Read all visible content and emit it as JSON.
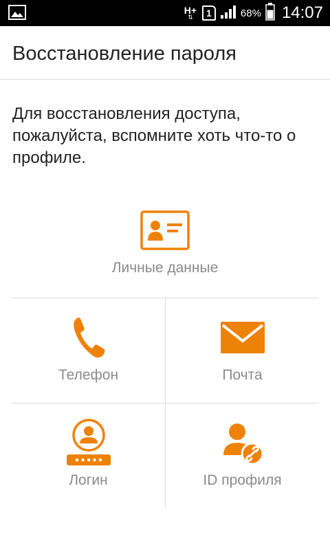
{
  "status_bar": {
    "network_label": "H+",
    "sim_slot": "1",
    "battery_percent": "68%",
    "time": "14:07",
    "battery_level": 0.68
  },
  "header": {
    "title": "Восстановление пароля"
  },
  "description": "Для восстановления доступа, пожалуйста, вспомните хоть что-то о профиле.",
  "options": {
    "personal": {
      "label": "Личные данные",
      "icon": "id-card-icon"
    },
    "phone": {
      "label": "Телефон",
      "icon": "phone-icon"
    },
    "mail": {
      "label": "Почта",
      "icon": "mail-icon"
    },
    "login": {
      "label": "Логин",
      "icon": "login-user-icon"
    },
    "profile_id": {
      "label": "ID профиля",
      "icon": "user-link-icon"
    }
  },
  "colors": {
    "accent": "#ee8208",
    "label": "#8a8a8a",
    "divider": "#dedede"
  }
}
